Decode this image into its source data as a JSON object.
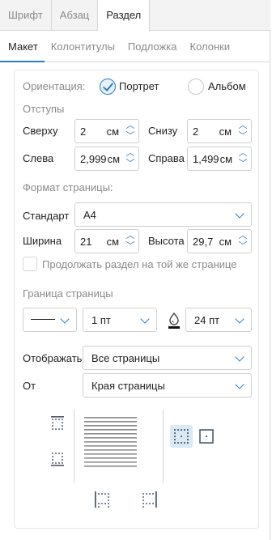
{
  "top_tabs": [
    {
      "label": "Шрифт"
    },
    {
      "label": "Абзац"
    },
    {
      "label": "Раздел"
    }
  ],
  "sub_tabs": [
    {
      "label": "Макет"
    },
    {
      "label": "Колонтитулы"
    },
    {
      "label": "Подложка"
    },
    {
      "label": "Колонки"
    }
  ],
  "orientation": {
    "label": "Ориентация:",
    "portrait": "Портрет",
    "landscape": "Альбом",
    "selected": "Портрет"
  },
  "margins": {
    "title": "Отступы",
    "top_label": "Сверху",
    "top_value": "2",
    "top_unit": "см",
    "bottom_label": "Снизу",
    "bottom_value": "2",
    "bottom_unit": "см",
    "left_label": "Слева",
    "left_value": "2,999",
    "left_unit": "см",
    "right_label": "Справа",
    "right_value": "1,499",
    "right_unit": "см"
  },
  "page_format": {
    "title": "Формат страницы:",
    "standard_label": "Стандарт",
    "standard_value": "A4",
    "width_label": "Ширина",
    "width_value": "21",
    "width_unit": "см",
    "height_label": "Высота",
    "height_value": "29,7",
    "height_unit": "см",
    "continue_label": "Продолжать раздел на той же странице"
  },
  "border": {
    "title": "Граница страницы",
    "width_value": "1 пт",
    "offset_value": "24 пт",
    "display_label": "Отображать",
    "display_value": "Все страницы",
    "from_label": "От",
    "from_value": "Края страницы"
  },
  "colors": {
    "accent": "#2b7ec1",
    "muted": "#8a8a8a",
    "border": "#cfcfcf"
  }
}
